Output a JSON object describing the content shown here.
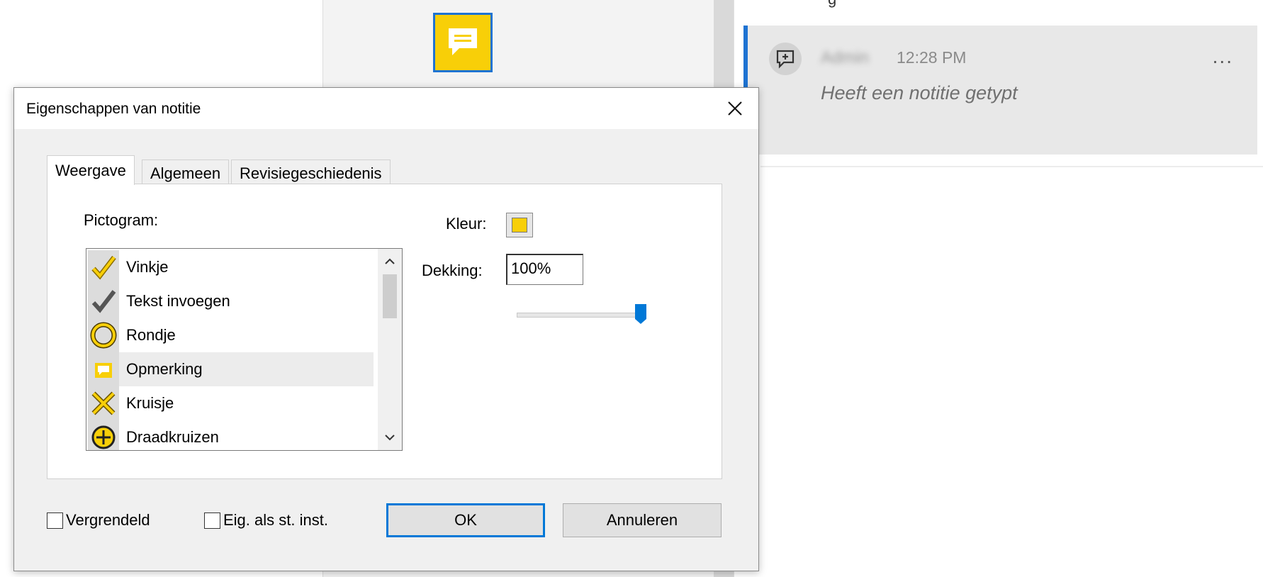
{
  "comment": {
    "author": "Admin",
    "time": "12:28 PM",
    "more": "...",
    "text": "Heeft een notitie getypt"
  },
  "dialog": {
    "title": "Eigenschappen van notitie",
    "close": "✕",
    "tabs": [
      "Weergave",
      "Algemeen",
      "Revisiegeschiedenis"
    ],
    "active_tab": "Weergave",
    "icon_label": "Pictogram:",
    "icons": [
      {
        "label": "Vinkje",
        "icon": "checkmark-icon"
      },
      {
        "label": "Tekst invoegen",
        "icon": "insert-text-icon"
      },
      {
        "label": "Rondje",
        "icon": "circle-icon"
      },
      {
        "label": "Opmerking",
        "icon": "comment-icon"
      },
      {
        "label": "Kruisje",
        "icon": "cross-icon"
      },
      {
        "label": "Draadkruizen",
        "icon": "crosshairs-icon"
      }
    ],
    "selected_icon": "Opmerking",
    "color_label": "Kleur:",
    "color_value": "#f8cf08",
    "opacity_label": "Dekking:",
    "opacity_value": "100%",
    "opacity_slider": 1.0,
    "locked_label": "Vergrendeld",
    "locked": false,
    "default_label": "Eig. als st. inst.",
    "default": false,
    "ok_label": "OK",
    "cancel_label": "Annuleren"
  },
  "colors": {
    "accent": "#1e73d2",
    "note_yellow": "#f8cf08"
  }
}
